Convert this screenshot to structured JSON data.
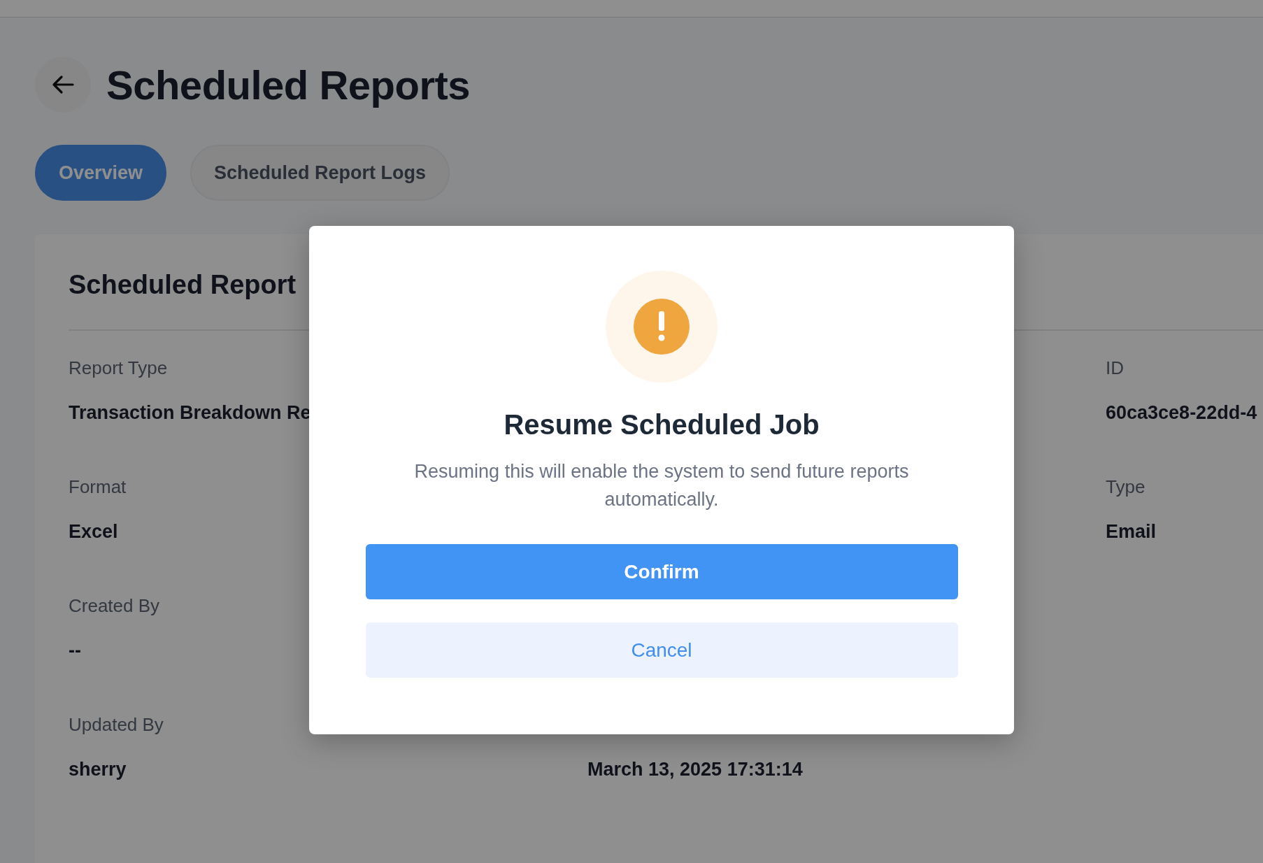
{
  "page": {
    "title": "Scheduled Reports"
  },
  "tabs": [
    {
      "label": "Overview",
      "selected": true
    },
    {
      "label": "Scheduled Report Logs",
      "selected": false
    }
  ],
  "card": {
    "title": "Scheduled Report",
    "columns": [
      [
        {
          "label": "Report Type",
          "value": "Transaction Breakdown Re"
        },
        {
          "label": "Format",
          "value": "Excel"
        },
        {
          "label": "Created By",
          "value": "--"
        },
        {
          "label": "Updated By",
          "value": "sherry"
        }
      ],
      [
        {
          "value": "March 13, 2025 17:31:14"
        }
      ],
      [
        {
          "label": "ID",
          "value": "60ca3ce8-22dd-4"
        },
        {
          "label": "Type",
          "value": "Email"
        }
      ]
    ]
  },
  "dialog": {
    "title": "Resume Scheduled Job",
    "message": "Resuming this will enable the system to send future reports automatically.",
    "confirm": "Confirm",
    "cancel": "Cancel"
  }
}
